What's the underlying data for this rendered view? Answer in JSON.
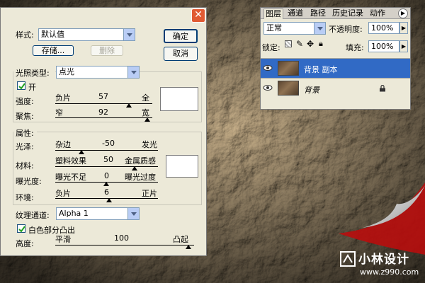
{
  "dialog": {
    "style_label": "样式:",
    "style_value": "默认值",
    "save_btn": "存储...",
    "delete_btn": "删除",
    "ok_btn": "确定",
    "cancel_btn": "取消",
    "light_type_label": "光照类型:",
    "light_type_value": "点光",
    "on_label": "开",
    "intensity": {
      "label": "强度:",
      "left": "负片",
      "value": "57",
      "right": "全"
    },
    "focus": {
      "label": "聚焦:",
      "left": "窄",
      "value": "92",
      "right": "宽"
    },
    "properties_label": "属性:",
    "gloss": {
      "label": "光泽:",
      "left": "杂边",
      "value": "-50",
      "right": "发光"
    },
    "material": {
      "label": "材料:",
      "left": "塑料效果",
      "value": "50",
      "right": "金属质感"
    },
    "exposure": {
      "label": "曝光度:",
      "left": "曝光不足",
      "value": "0",
      "right": "曝光过度"
    },
    "ambience": {
      "label": "环境:",
      "left": "负片",
      "value": "6",
      "right": "正片"
    },
    "texture_label": "纹理通道:",
    "texture_value": "Alpha 1",
    "white_high_label": "白色部分凸出",
    "height": {
      "label": "高度:",
      "left": "平滑",
      "value": "100",
      "right": "凸起"
    }
  },
  "layers": {
    "tabs": [
      "图层",
      "通道",
      "路径",
      "历史记录",
      "动作"
    ],
    "blend_mode": "正常",
    "opacity_label": "不透明度:",
    "opacity_value": "100%",
    "lock_label": "锁定:",
    "fill_label": "填充:",
    "fill_value": "100%",
    "items": [
      {
        "name": "背景 副本",
        "selected": true,
        "icon": "layer-thumbnail"
      },
      {
        "name": "背景",
        "selected": false,
        "icon": "lock-icon"
      }
    ]
  },
  "watermark": {
    "title": "小林设计",
    "url": "www.z990.com"
  },
  "colors": {
    "dialog_bg": "#ece9d8",
    "selection": "#316ac5",
    "close_red": "#e05a33",
    "brand_red": "#b80d0d"
  }
}
